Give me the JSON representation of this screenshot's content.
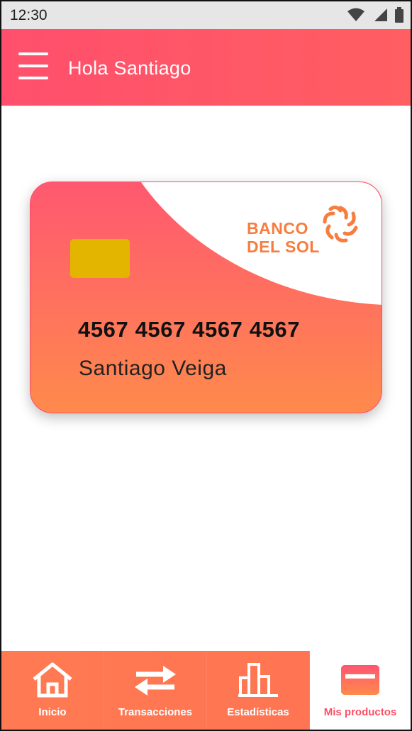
{
  "status_bar": {
    "time": "12:30",
    "icons": [
      "wifi-icon",
      "signal-icon",
      "battery-icon"
    ]
  },
  "header": {
    "greeting": "Hola Santiago",
    "menu_icon": "hamburger-menu-icon"
  },
  "card": {
    "bank_name_line1": "BANCO",
    "bank_name_line2": "DEL SOL",
    "number": "4567 4567 4567 4567",
    "holder": "Santiago Veiga",
    "colors": {
      "gradient_top": "#ff5870",
      "gradient_bottom": "#ff8a4c",
      "chip": "#e3b400",
      "logo": "#f77d3e"
    }
  },
  "bottom_nav": {
    "items": [
      {
        "label": "Inicio",
        "icon": "home-icon"
      },
      {
        "label": "Transacciones",
        "icon": "swap-arrows-icon"
      },
      {
        "label": "Estadísticas",
        "icon": "bar-chart-icon"
      },
      {
        "label": "Mis productos",
        "icon": "credit-card-icon",
        "active": true
      }
    ]
  },
  "colors": {
    "accent": "#ff4f6c",
    "nav_bg": "#ff7a52"
  }
}
